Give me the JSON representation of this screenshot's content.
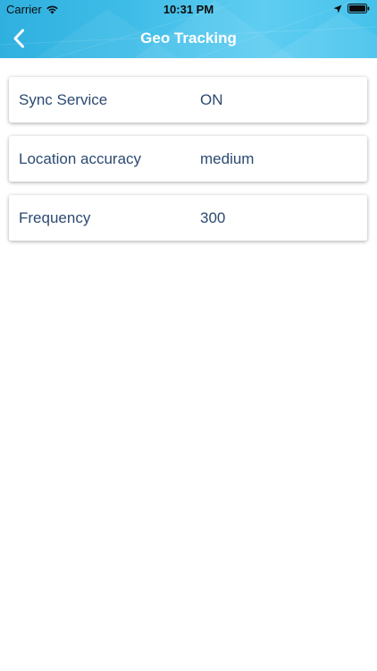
{
  "status_bar": {
    "carrier": "Carrier",
    "time": "10:31 PM"
  },
  "nav": {
    "title": "Geo Tracking",
    "back_icon": "chevron-left-icon"
  },
  "settings": [
    {
      "label": "Sync Service",
      "value": "ON"
    },
    {
      "label": "Location accuracy",
      "value": "medium"
    },
    {
      "label": "Frequency",
      "value": "300"
    }
  ],
  "colors": {
    "header": "#3fbde8",
    "text": "#2c4a72",
    "background": "#ffffff"
  }
}
